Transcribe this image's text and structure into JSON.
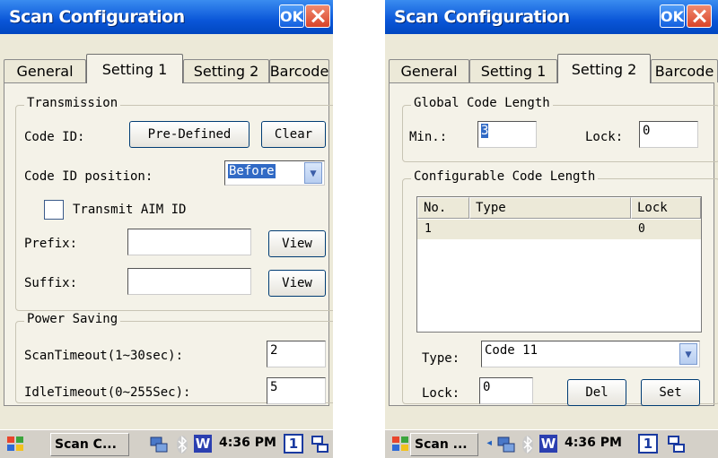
{
  "screen1": {
    "title": "Scan Configuration",
    "ok": "OK",
    "tabs": [
      "General",
      "Setting 1",
      "Setting 2",
      "Barcode"
    ],
    "transmission": {
      "legend": "Transmission",
      "code_id_label": "Code ID:",
      "predefined_button": "Pre-Defined",
      "clear_button": "Clear",
      "position_label": "Code ID position:",
      "position_value": "Before",
      "aim_label": "Transmit AIM ID",
      "prefix_label": "Prefix:",
      "prefix_value": "",
      "suffix_label": "Suffix:",
      "suffix_value": "",
      "view_button": "View"
    },
    "power": {
      "legend": "Power Saving",
      "scan_label": "ScanTimeout(1~30sec):",
      "scan_value": "2",
      "idle_label": "IdleTimeout(0~255Sec):",
      "idle_value": "5"
    },
    "taskbar": {
      "task": "Scan C...",
      "time": "4:36 PM",
      "w": "W",
      "num": "1"
    }
  },
  "screen2": {
    "title": "Scan Configuration",
    "ok": "OK",
    "tabs": [
      "General",
      "Setting 1",
      "Setting 2",
      "Barcode"
    ],
    "global": {
      "legend": "Global Code Length",
      "min_label": "Min.:",
      "min_value": "3",
      "lock_label": "Lock:",
      "lock_value": "0"
    },
    "configurable": {
      "legend": "Configurable Code Length",
      "columns": [
        "No.",
        "Type",
        "Lock"
      ],
      "rows": [
        {
          "no": "1",
          "type": "",
          "lock": "0"
        }
      ],
      "type_label": "Type:",
      "type_value": "Code 11",
      "lock_label": "Lock:",
      "lock_value": "0",
      "del_button": "Del",
      "set_button": "Set"
    },
    "taskbar": {
      "task": "Scan ...",
      "time": "4:36 PM",
      "w": "W",
      "num": "1"
    }
  }
}
